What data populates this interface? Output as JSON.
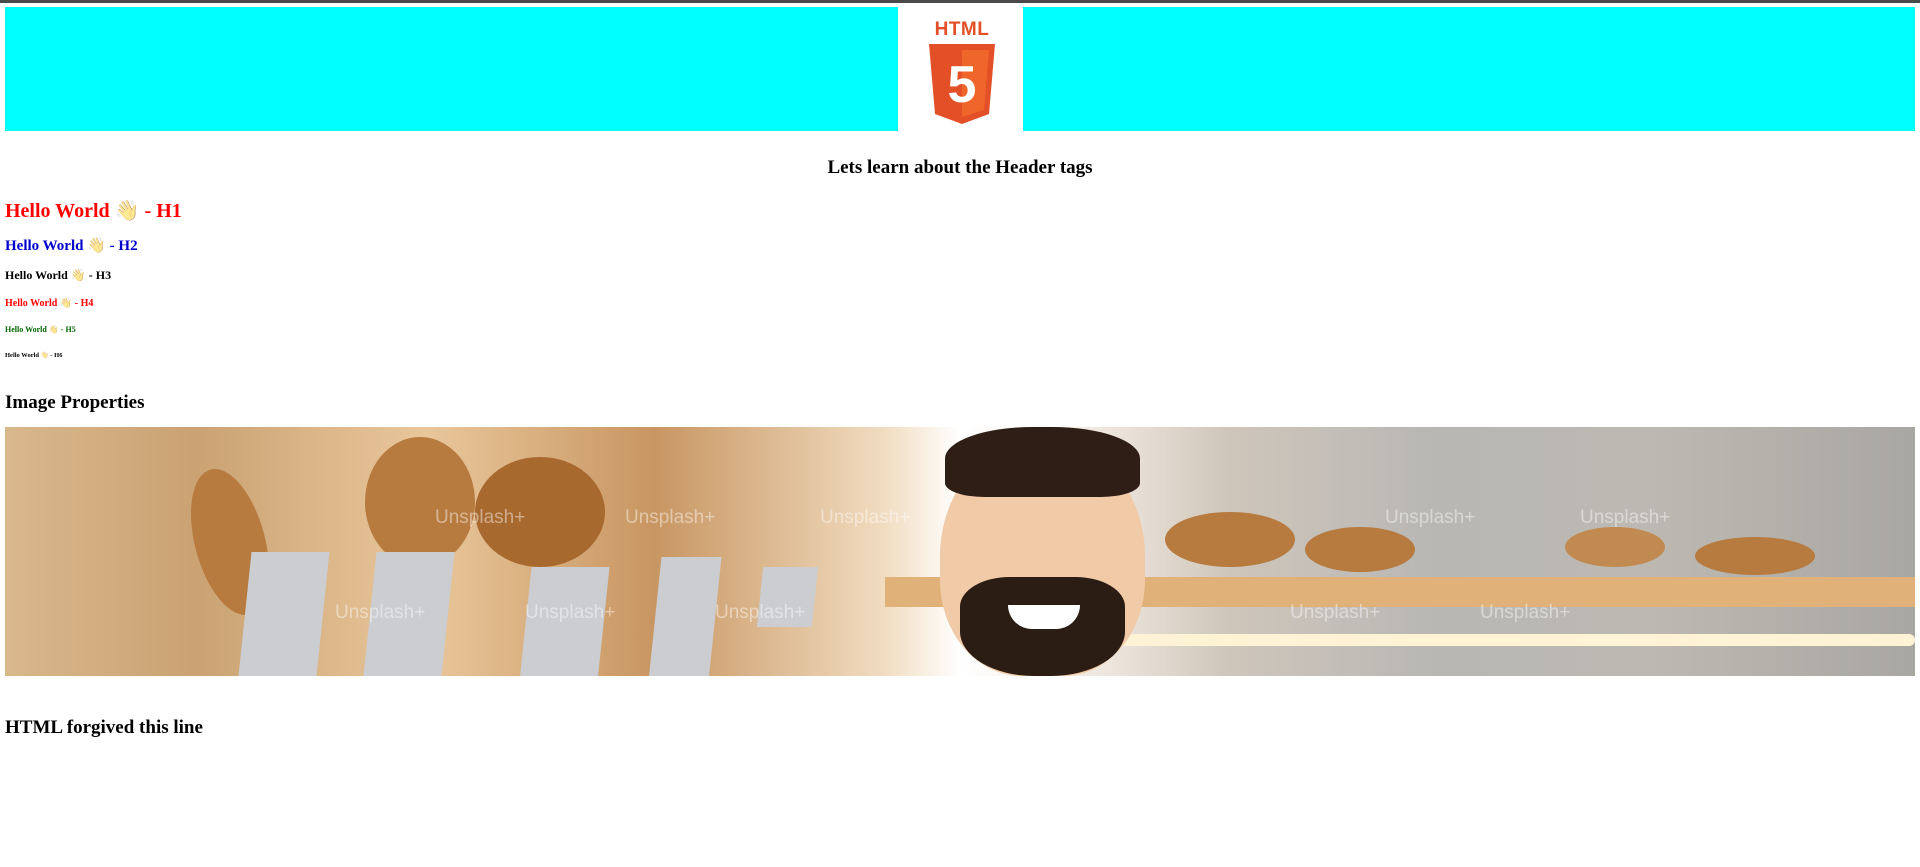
{
  "banner": {
    "logo_text": "HTML",
    "logo_digit": "5",
    "colors": {
      "background": "#00ffff",
      "logo_orange": "#e34f26",
      "logo_shield_light": "#f06529"
    }
  },
  "intro": {
    "text": "Lets learn about the Header tags"
  },
  "headings": [
    {
      "text": "Hello World",
      "icon": "raised-hand-icon",
      "suffix": "- H1",
      "color": "#ff0000"
    },
    {
      "text": "Hello World",
      "icon": "raised-hand-icon",
      "suffix": "- H2",
      "color": "#0000cd"
    },
    {
      "text": "Hello World",
      "icon": "raised-hand-icon",
      "suffix": "- H3",
      "color": "#000000"
    },
    {
      "text": "Hello World",
      "icon": "raised-hand-icon",
      "suffix": "- H4",
      "color": "#ff0000"
    },
    {
      "text": "Hello World",
      "icon": "raised-hand-icon",
      "suffix": "- H5",
      "color": "#006400"
    },
    {
      "text": "Hello World",
      "icon": "raised-hand-icon",
      "suffix": "- H6",
      "color": "#000000"
    }
  ],
  "hand_glyph": "👋",
  "image_section": {
    "title": "Image Properties",
    "watermark": "Unsplash+"
  },
  "footer": {
    "text": "HTML forgived this line"
  }
}
